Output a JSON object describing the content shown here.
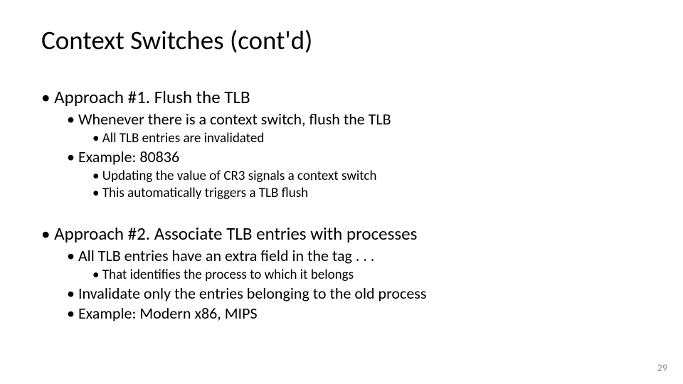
{
  "title": "Context Switches (cont'd)",
  "approach1": {
    "heading": "Approach #1. Flush the TLB",
    "sub1": "Whenever there is a context switch, flush the TLB",
    "sub1_a": "All TLB entries are invalidated",
    "sub2": "Example: 80836",
    "sub2_a": "Updating the value of CR3 signals a context switch",
    "sub2_b": "This automatically triggers a TLB flush"
  },
  "approach2": {
    "heading": "Approach #2. Associate TLB entries with processes",
    "sub1": "All TLB entries have an extra field in the tag . . .",
    "sub1_a": "That identifies the process to which it belongs",
    "sub2": "Invalidate only the entries belonging to the old process",
    "sub3": "Example: Modern x86, MIPS"
  },
  "page_number": "29"
}
